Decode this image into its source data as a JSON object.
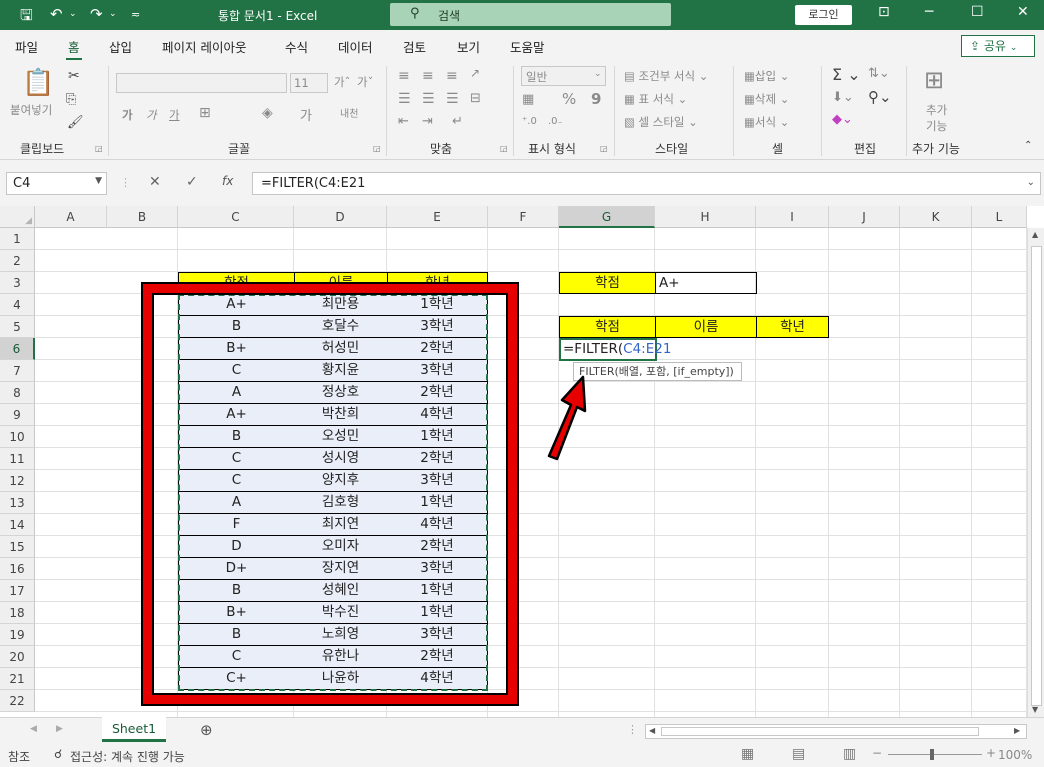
{
  "window": {
    "title": "통합 문서1  -  Excel",
    "search_placeholder": "검색",
    "login_label": "로그인",
    "share_label": "공유"
  },
  "ribbon_tabs": [
    "파일",
    "홈",
    "삽입",
    "페이지 레이아웃",
    "수식",
    "데이터",
    "검토",
    "보기",
    "도움말"
  ],
  "active_tab": "홈",
  "ribbon": {
    "clipboard": {
      "paste": "붙여넣기",
      "label": "클립보드"
    },
    "font": {
      "font_size": "11",
      "bold": "가",
      "italic": "가",
      "underline": "가",
      "label": "글꼴"
    },
    "alignment": {
      "label": "맞춤"
    },
    "number": {
      "format": "일반",
      "percent": "%",
      "comma": "9",
      "label": "표시 형식"
    },
    "styles": {
      "conditional": "조건부 서식",
      "table": "표 서식",
      "cell_style": "셀 스타일",
      "label": "스타일"
    },
    "cells": {
      "insert": "삽입",
      "delete": "삭제",
      "format": "서식",
      "label": "셀"
    },
    "editing": {
      "label": "편집"
    },
    "addins": {
      "button_line1": "추가",
      "button_line2": "기능",
      "label": "추가 기능"
    }
  },
  "formula_bar": {
    "name_box": "C4",
    "formula": "=FILTER(C4:E21",
    "fx": "fx"
  },
  "columns": [
    "A",
    "B",
    "C",
    "D",
    "E",
    "F",
    "G",
    "H",
    "I",
    "J",
    "K",
    "L"
  ],
  "rows": [
    "1",
    "2",
    "3",
    "4",
    "5",
    "6",
    "7",
    "8",
    "9",
    "10",
    "11",
    "12",
    "13",
    "14",
    "15",
    "16",
    "17",
    "18",
    "19",
    "20",
    "21",
    "22"
  ],
  "table": {
    "headers": [
      "학점",
      "이름",
      "학년"
    ],
    "rows": [
      [
        "A+",
        "최만용",
        "1학년"
      ],
      [
        "B",
        "호달수",
        "3학년"
      ],
      [
        "B+",
        "허성민",
        "2학년"
      ],
      [
        "C",
        "황지윤",
        "3학년"
      ],
      [
        "A",
        "정상호",
        "2학년"
      ],
      [
        "A+",
        "박찬희",
        "4학년"
      ],
      [
        "B",
        "오성민",
        "1학년"
      ],
      [
        "C",
        "성시영",
        "2학년"
      ],
      [
        "C",
        "양지후",
        "3학년"
      ],
      [
        "A",
        "김호형",
        "1학년"
      ],
      [
        "F",
        "최지연",
        "4학년"
      ],
      [
        "D",
        "오미자",
        "2학년"
      ],
      [
        "D+",
        "장지연",
        "3학년"
      ],
      [
        "B",
        "성혜인",
        "1학년"
      ],
      [
        "B+",
        "박수진",
        "1학년"
      ],
      [
        "B",
        "노희영",
        "3학년"
      ],
      [
        "C",
        "유한나",
        "2학년"
      ],
      [
        "C+",
        "나윤하",
        "4학년"
      ]
    ]
  },
  "criteria": {
    "label": "학점",
    "value": "A+"
  },
  "result_headers": [
    "학점",
    "이름",
    "학년"
  ],
  "active_cell": {
    "formula_prefix": "=FILTER(",
    "range_ref": "C4:E21"
  },
  "tooltip": "FILTER(배열, 포함, [if_empty])",
  "sheet_tab": "Sheet1",
  "status": {
    "mode": "참조",
    "accessibility": "접근성: 계속 진행 가능",
    "zoom": "100%"
  },
  "colors": {
    "accent": "#217346",
    "highlight": "#ffff00",
    "annotation": "#e60000"
  }
}
